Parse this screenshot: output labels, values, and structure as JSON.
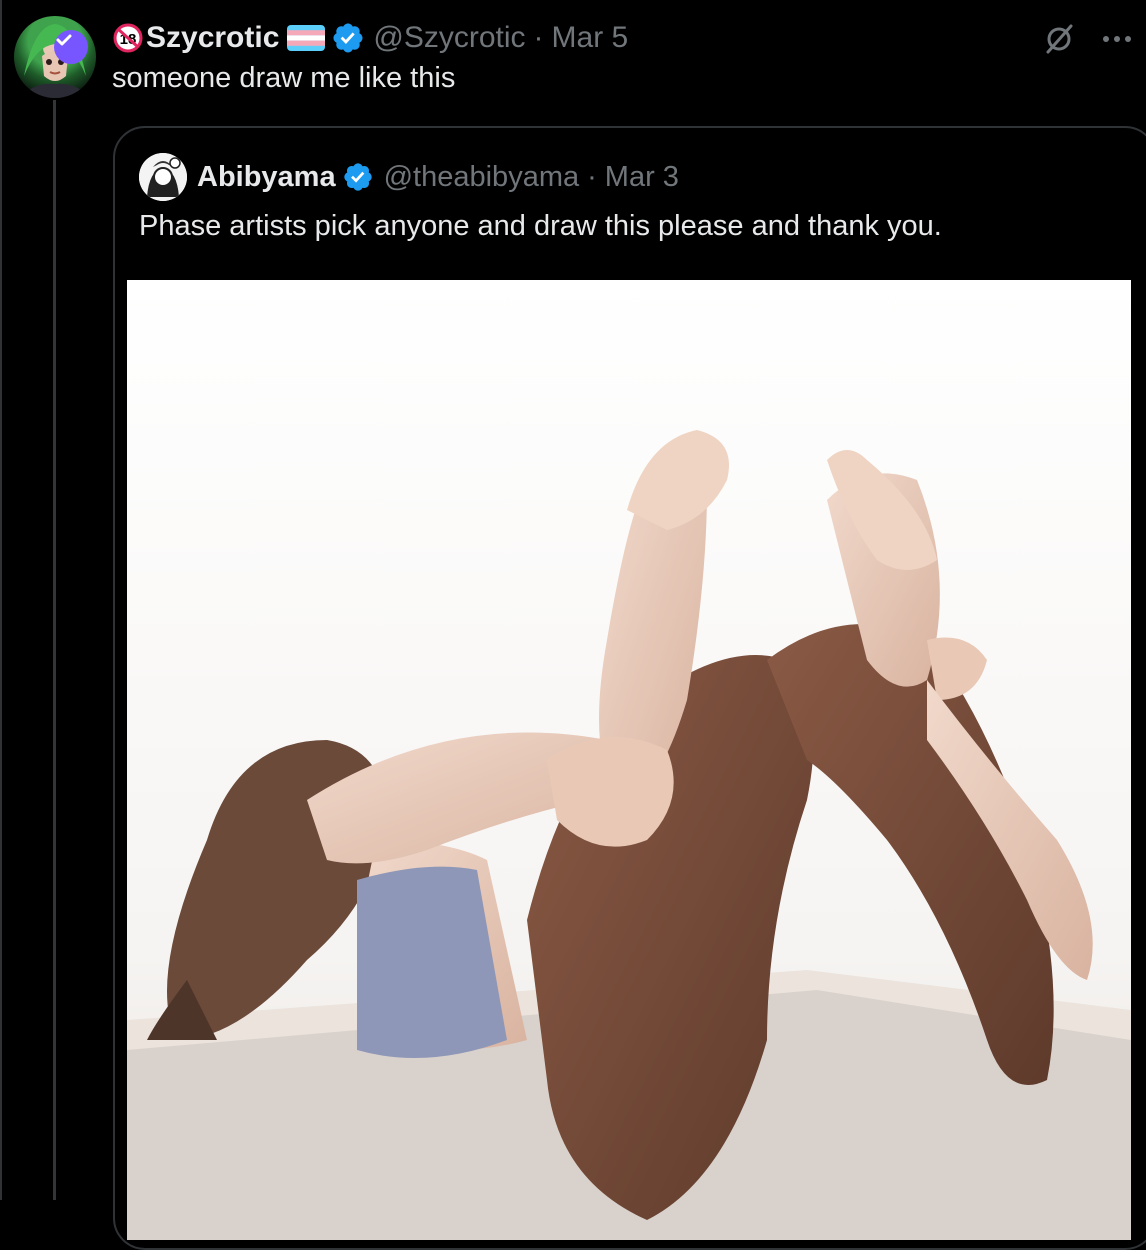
{
  "colors": {
    "background": "#000000",
    "text_primary": "#e7e9ea",
    "text_secondary": "#71767b",
    "verified_blue": "#1d9bf0",
    "border": "#2f3336",
    "avatar_badge": "#7856ff"
  },
  "tweet": {
    "display_name": "Szycrotic",
    "handle": "@Szycrotic",
    "separator": "·",
    "date": "Mar 5",
    "text": "someone draw me like this",
    "icons": [
      "no-under-18-icon",
      "trans-flag-icon",
      "verified-badge-icon",
      "grok-icon",
      "more-icon"
    ]
  },
  "quoted_tweet": {
    "display_name": "Abibyama",
    "handle": "@theabibyama",
    "separator": "·",
    "date": "Mar 3",
    "text": "Phase artists pick anyone and draw this please and thank you.",
    "media": {
      "kind": "photo",
      "icon": "photo-media"
    }
  }
}
